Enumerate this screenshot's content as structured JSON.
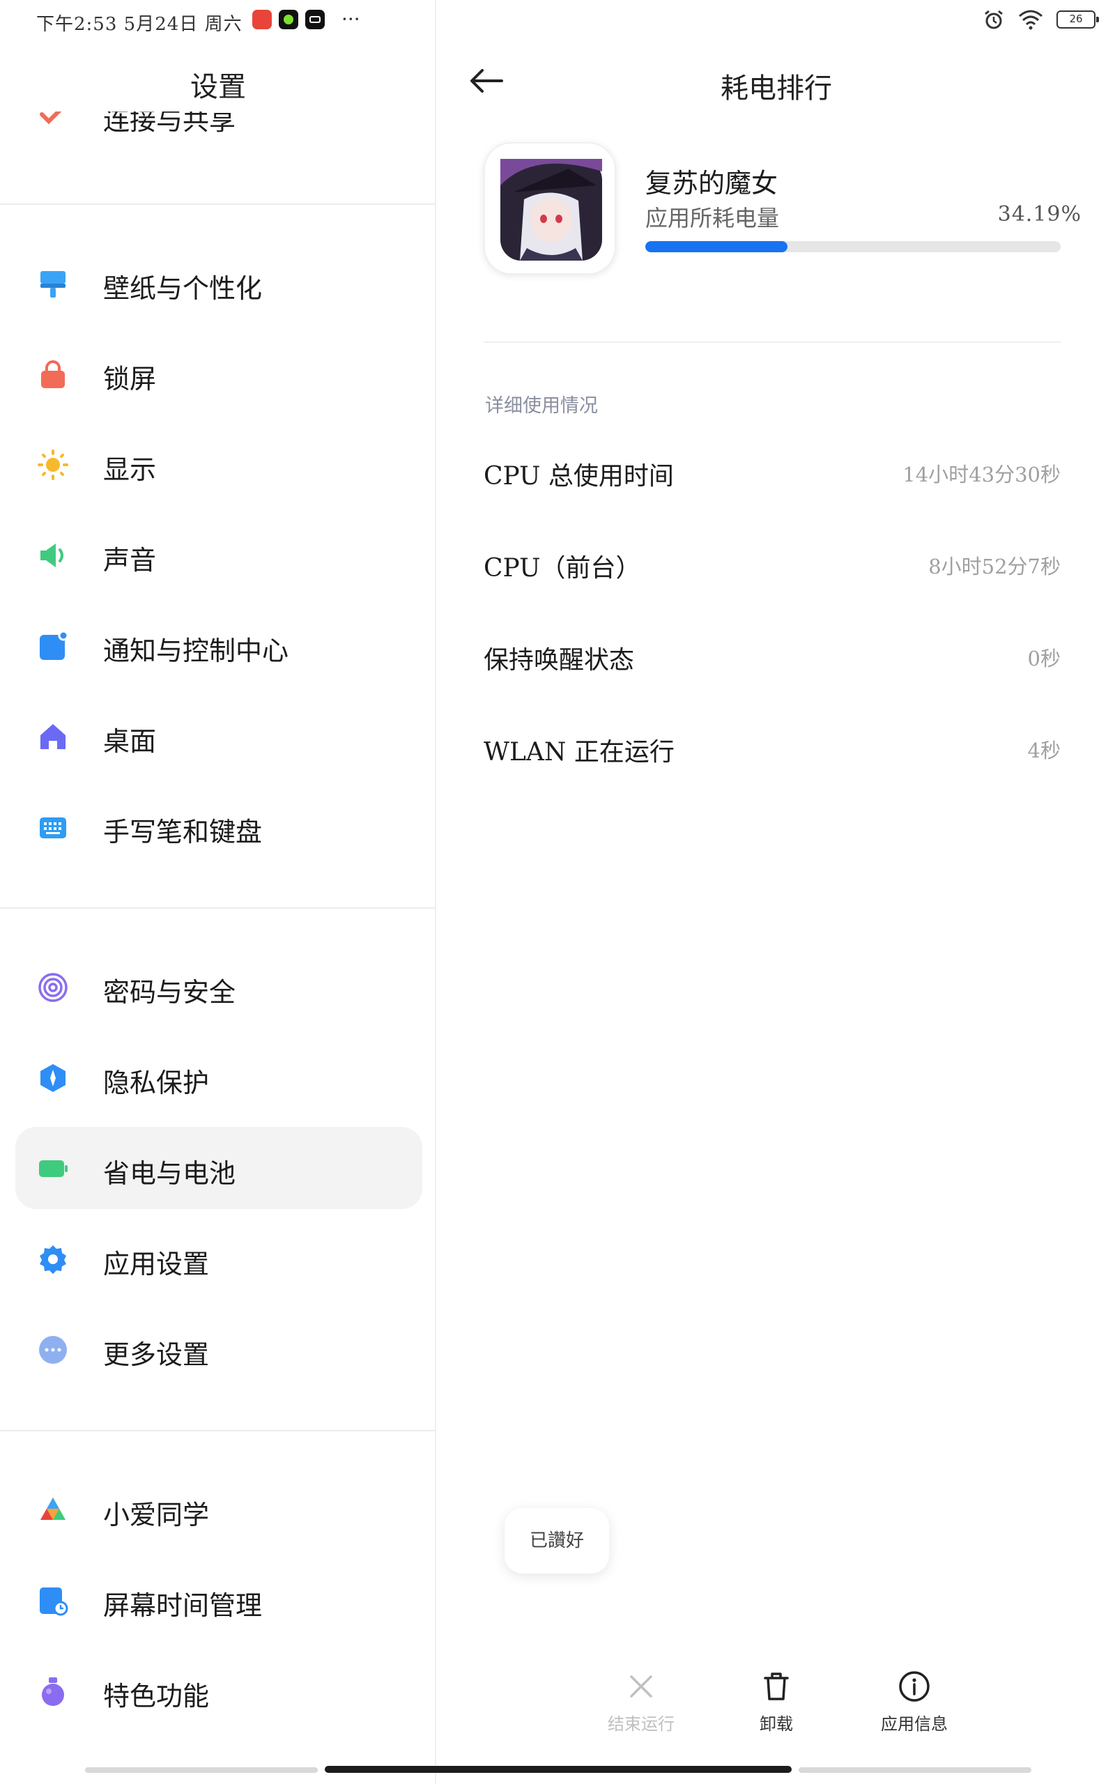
{
  "status_bar": {
    "time": "下午2:53",
    "date": "5月24日",
    "weekday": "周六",
    "overflow": "···",
    "battery_level": "26",
    "app_icons": [
      "taobao-icon",
      "green-dot-app-icon",
      "capcut-icon"
    ]
  },
  "sidebar": {
    "title": "设置",
    "partial_item": "连接与共享",
    "groups": [
      {
        "items": [
          {
            "label": "壁纸与个性化",
            "icon": "wallpaper-icon",
            "color": "#3ba3f5"
          },
          {
            "label": "锁屏",
            "icon": "lock-icon",
            "color": "#f26b57"
          },
          {
            "label": "显示",
            "icon": "sun-icon",
            "color": "#f7b92a"
          },
          {
            "label": "声音",
            "icon": "speaker-icon",
            "color": "#3fcb7e"
          },
          {
            "label": "通知与控制中心",
            "icon": "notification-icon",
            "color": "#2e8ef5"
          },
          {
            "label": "桌面",
            "icon": "home-icon",
            "color": "#6a6af5"
          },
          {
            "label": "手写笔和键盘",
            "icon": "keyboard-icon",
            "color": "#2e9cf5"
          }
        ]
      },
      {
        "items": [
          {
            "label": "密码与安全",
            "icon": "fingerprint-icon",
            "color": "#8a6cf0"
          },
          {
            "label": "隐私保护",
            "icon": "privacy-icon",
            "color": "#2e8ef5"
          },
          {
            "label": "省电与电池",
            "icon": "battery-icon",
            "color": "#3fcb7e",
            "active": true
          },
          {
            "label": "应用设置",
            "icon": "gear-icon",
            "color": "#2e8ef5"
          },
          {
            "label": "更多设置",
            "icon": "more-icon",
            "color": "#8fb0f0"
          }
        ]
      },
      {
        "items": [
          {
            "label": "小爱同学",
            "icon": "xiaoai-icon",
            "color": "#f5a33a"
          },
          {
            "label": "屏幕时间管理",
            "icon": "screen-time-icon",
            "color": "#2e8ef5"
          },
          {
            "label": "特色功能",
            "icon": "potion-icon",
            "color": "#8a6cf0"
          }
        ]
      }
    ]
  },
  "detail": {
    "title": "耗电排行",
    "app_name": "复苏的魔女",
    "usage_label": "应用所耗电量",
    "usage_percent_text": "34.19%",
    "usage_fraction": 0.3419,
    "bar_color": "#1873f0",
    "section_title": "详细使用情况",
    "rows": [
      {
        "label": "CPU 总使用时间",
        "value": "14小时43分30秒"
      },
      {
        "label": "CPU（前台）",
        "value": "8小时52分7秒"
      },
      {
        "label": "保持唤醒状态",
        "value": "0秒"
      },
      {
        "label": "WLAN 正在运行",
        "value": "4秒"
      }
    ],
    "toast": "已讚好",
    "actions": [
      {
        "label": "结束运行",
        "icon": "close-icon",
        "enabled": false
      },
      {
        "label": "卸载",
        "icon": "trash-icon",
        "enabled": true
      },
      {
        "label": "应用信息",
        "icon": "info-icon",
        "enabled": true
      }
    ]
  }
}
